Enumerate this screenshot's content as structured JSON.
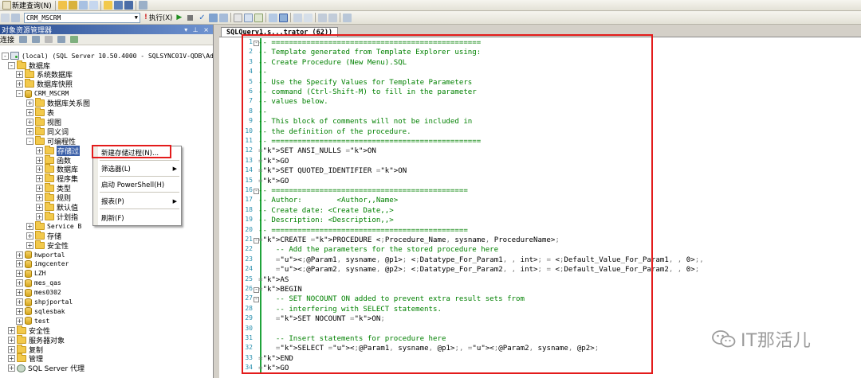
{
  "toolbar": {
    "new_query_label": "新建查询(N)",
    "database_combo": "CRM_MSCRM",
    "execute_label": "执行(X)"
  },
  "object_explorer": {
    "title": "对象资源管理器",
    "connect_label": "连接",
    "server_node": "(local) (SQL Server 10.50.4000 - SQLSYNC01V-QDB\\Administ",
    "tree": [
      {
        "label": "数据库",
        "icon": "folder-icon",
        "level": 1,
        "box": "-"
      },
      {
        "label": "系统数据库",
        "icon": "folder-icon",
        "level": 2,
        "box": "+"
      },
      {
        "label": "数据库快照",
        "icon": "folder-icon",
        "level": 2,
        "box": "+"
      },
      {
        "label": "CRM_MSCRM",
        "icon": "database-icon",
        "level": 2,
        "box": "-"
      },
      {
        "label": "数据库关系图",
        "icon": "folder-icon",
        "level": 3,
        "box": "+"
      },
      {
        "label": "表",
        "icon": "folder-icon",
        "level": 3,
        "box": "+"
      },
      {
        "label": "视图",
        "icon": "folder-icon",
        "level": 3,
        "box": "+"
      },
      {
        "label": "同义词",
        "icon": "folder-icon",
        "level": 3,
        "box": "+"
      },
      {
        "label": "可编程性",
        "icon": "folder-icon",
        "level": 3,
        "box": "-"
      },
      {
        "label": "存储过",
        "icon": "folder-icon",
        "level": 4,
        "box": "+",
        "selected": true
      },
      {
        "label": "函数",
        "icon": "folder-icon",
        "level": 4,
        "box": "+"
      },
      {
        "label": "数据库",
        "icon": "folder-icon",
        "level": 4,
        "box": "+"
      },
      {
        "label": "程序集",
        "icon": "folder-icon",
        "level": 4,
        "box": "+"
      },
      {
        "label": "类型",
        "icon": "folder-icon",
        "level": 4,
        "box": "+"
      },
      {
        "label": "规则",
        "icon": "folder-icon",
        "level": 4,
        "box": "+"
      },
      {
        "label": "默认值",
        "icon": "folder-icon",
        "level": 4,
        "box": "+"
      },
      {
        "label": "计划指",
        "icon": "folder-icon",
        "level": 4,
        "box": "+"
      },
      {
        "label": "Service B",
        "icon": "folder-icon",
        "level": 3,
        "box": "+"
      },
      {
        "label": "存储",
        "icon": "folder-icon",
        "level": 3,
        "box": "+"
      },
      {
        "label": "安全性",
        "icon": "folder-icon",
        "level": 3,
        "box": "+"
      },
      {
        "label": "hwportal",
        "icon": "database-icon",
        "level": 2,
        "box": "+"
      },
      {
        "label": "imgcenter",
        "icon": "database-icon",
        "level": 2,
        "box": "+"
      },
      {
        "label": "LZH",
        "icon": "database-icon",
        "level": 2,
        "box": "+"
      },
      {
        "label": "mes_qas",
        "icon": "database-icon",
        "level": 2,
        "box": "+"
      },
      {
        "label": "mes0302",
        "icon": "database-icon",
        "level": 2,
        "box": "+"
      },
      {
        "label": "shpjportal",
        "icon": "database-icon",
        "level": 2,
        "box": "+"
      },
      {
        "label": "sqlesbak",
        "icon": "database-icon",
        "level": 2,
        "box": "+"
      },
      {
        "label": "test",
        "icon": "database-icon",
        "level": 2,
        "box": "+"
      },
      {
        "label": "安全性",
        "icon": "folder-icon",
        "level": 1,
        "box": "+"
      },
      {
        "label": "服务器对象",
        "icon": "folder-icon",
        "level": 1,
        "box": "+"
      },
      {
        "label": "复制",
        "icon": "folder-icon",
        "level": 1,
        "box": "+"
      },
      {
        "label": "管理",
        "icon": "folder-icon",
        "level": 1,
        "box": "+"
      },
      {
        "label": "SQL Server 代理",
        "icon": "agent-icon",
        "level": 1,
        "box": "+"
      }
    ]
  },
  "context_menu": {
    "items": [
      {
        "label": "新建存储过程(N)...",
        "submenu": false
      },
      {
        "label": "筛选器(L)",
        "submenu": true
      },
      {
        "label": "启动 PowerShell(H)",
        "submenu": false
      },
      {
        "label": "报表(P)",
        "submenu": true
      },
      {
        "label": "刷新(F)",
        "submenu": false
      }
    ]
  },
  "editor": {
    "tab_label": "SQLQuery1.s...trator (62))",
    "lines": [
      "-- ================================================",
      "-- Template generated from Template Explorer using:",
      "-- Create Procedure (New Menu).SQL",
      "--",
      "-- Use the Specify Values for Template Parameters",
      "-- command (Ctrl-Shift-M) to fill in the parameter",
      "-- values below.",
      "--",
      "-- This block of comments will not be included in",
      "-- the definition of the procedure.",
      "-- ================================================",
      "SET ANSI_NULLS ON",
      "GO",
      "SET QUOTED_IDENTIFIER ON",
      "GO",
      "-- =============================================",
      "-- Author:\t\t<Author,,Name>",
      "-- Create date: <Create Date,,>",
      "-- Description: <Description,,>",
      "-- =============================================",
      "CREATE PROCEDURE <Procedure_Name, sysname, ProcedureName>",
      "\t-- Add the parameters for the stored procedure here",
      "\t<@Param1, sysname, @p1> <Datatype_For_Param1, , int> = <Default_Value_For_Param1, , 0>,",
      "\t<@Param2, sysname, @p2> <Datatype_For_Param2, , int> = <Default_Value_For_Param2, , 0>",
      "AS",
      "BEGIN",
      "\t-- SET NOCOUNT ON added to prevent extra result sets from",
      "\t-- interfering with SELECT statements.",
      "\tSET NOCOUNT ON;",
      "",
      "\t-- Insert statements for procedure here",
      "\tSELECT <@Param1, sysname, @p1>, <@Param2, sysname, @p2>",
      "END",
      "GO"
    ]
  },
  "watermark": {
    "text": "IT那活儿"
  },
  "colors": {
    "highlight_red": "#e31b1b",
    "comment_green": "#008000",
    "keyword_blue": "#0000ff",
    "selection_blue": "#3a5fa8"
  }
}
